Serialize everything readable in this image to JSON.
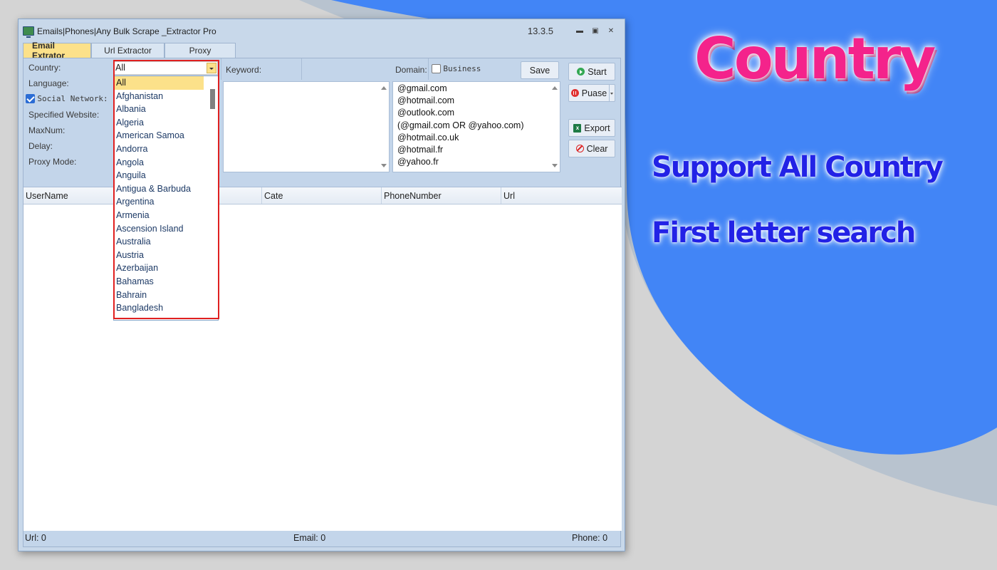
{
  "window": {
    "title": "Emails|Phones|Any Bulk Scrape _Extractor Pro",
    "version": "13.3.5"
  },
  "tabs": [
    {
      "label": "Email Extrator",
      "active": true
    },
    {
      "label": "Url Extractor",
      "active": false
    },
    {
      "label": "Proxy",
      "active": false
    }
  ],
  "form": {
    "country_label": "Country:",
    "country_value": "All",
    "language_label": "Language:",
    "social_network_label": "Social Network:",
    "social_network_checked": true,
    "specified_website_label": "Specified Website:",
    "maxnum_label": "MaxNum:",
    "delay_label": "Delay:",
    "proxy_mode_label": "Proxy Mode:",
    "keyword_label": "Keyword:",
    "domain_label": "Domain:",
    "business_label": "Business",
    "business_checked": false,
    "save_label": "Save"
  },
  "domains": [
    "@gmail.com",
    "@hotmail.com",
    "@outlook.com",
    "(@gmail.com OR @yahoo.com)",
    "@hotmail.co.uk",
    "@hotmail.fr",
    "@yahoo.fr"
  ],
  "actions": {
    "start": "Start",
    "pause": "Puase",
    "export": "Export",
    "clear": "Clear"
  },
  "grid": {
    "columns": [
      "UserName",
      "",
      "Cate",
      "PhoneNumber",
      "Url"
    ]
  },
  "status": {
    "url": "Url:  0",
    "email": "Email:  0",
    "phone": "Phone:  0"
  },
  "country_options": [
    "All",
    "Afghanistan",
    "Albania",
    "Algeria",
    "American Samoa",
    "Andorra",
    "Angola",
    "Anguila",
    "Antigua & Barbuda",
    "Argentina",
    "Armenia",
    "Ascension Island",
    "Australia",
    "Austria",
    "Azerbaijan",
    "Bahamas",
    "Bahrain",
    "Bangladesh"
  ],
  "promo": {
    "title": "Country",
    "line1": "Support All Country",
    "line2": "First letter search",
    "title_color": "#f4238b",
    "line_color": "#2222e6",
    "background_accent": "#4285f6"
  }
}
